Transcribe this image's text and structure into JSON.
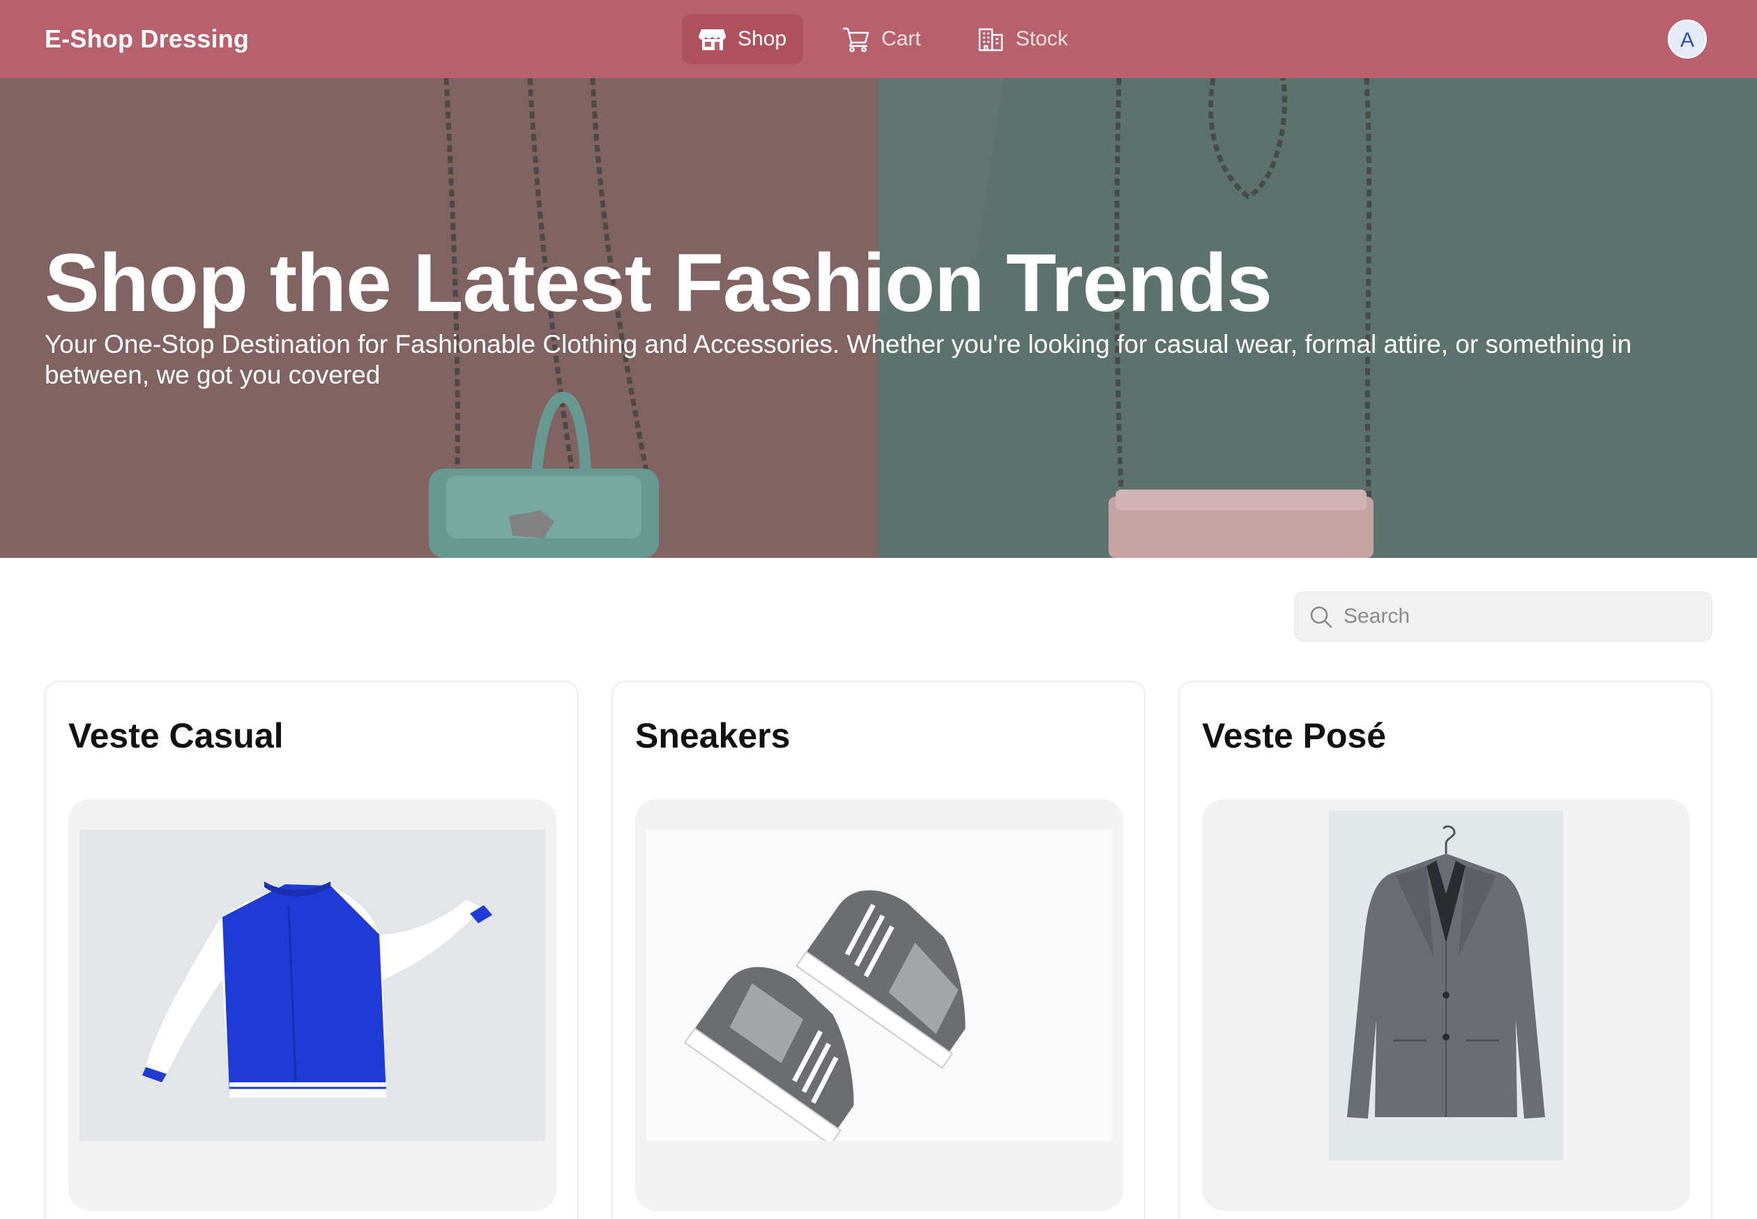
{
  "header": {
    "brand": "E-Shop Dressing",
    "nav": [
      {
        "label": "Shop",
        "icon": "store-icon",
        "active": true
      },
      {
        "label": "Cart",
        "icon": "cart-icon",
        "active": false
      },
      {
        "label": "Stock",
        "icon": "building-icon",
        "active": false
      }
    ],
    "avatar_initial": "A"
  },
  "hero": {
    "title": "Shop the Latest Fashion Trends",
    "subtitle": "Your One-Stop Destination for Fashionable Clothing and Accessories. Whether you're looking for casual wear, formal attire, or something in between, we got you covered"
  },
  "search": {
    "placeholder": "Search",
    "value": ""
  },
  "products": [
    {
      "name": "Veste Casual"
    },
    {
      "name": "Sneakers"
    },
    {
      "name": "Veste Posé"
    }
  ],
  "colors": {
    "header_bg": "#b9606d",
    "hero_left": "#8a6a6a",
    "hero_right": "#627a74",
    "image_frame": "#f2f2f2"
  }
}
